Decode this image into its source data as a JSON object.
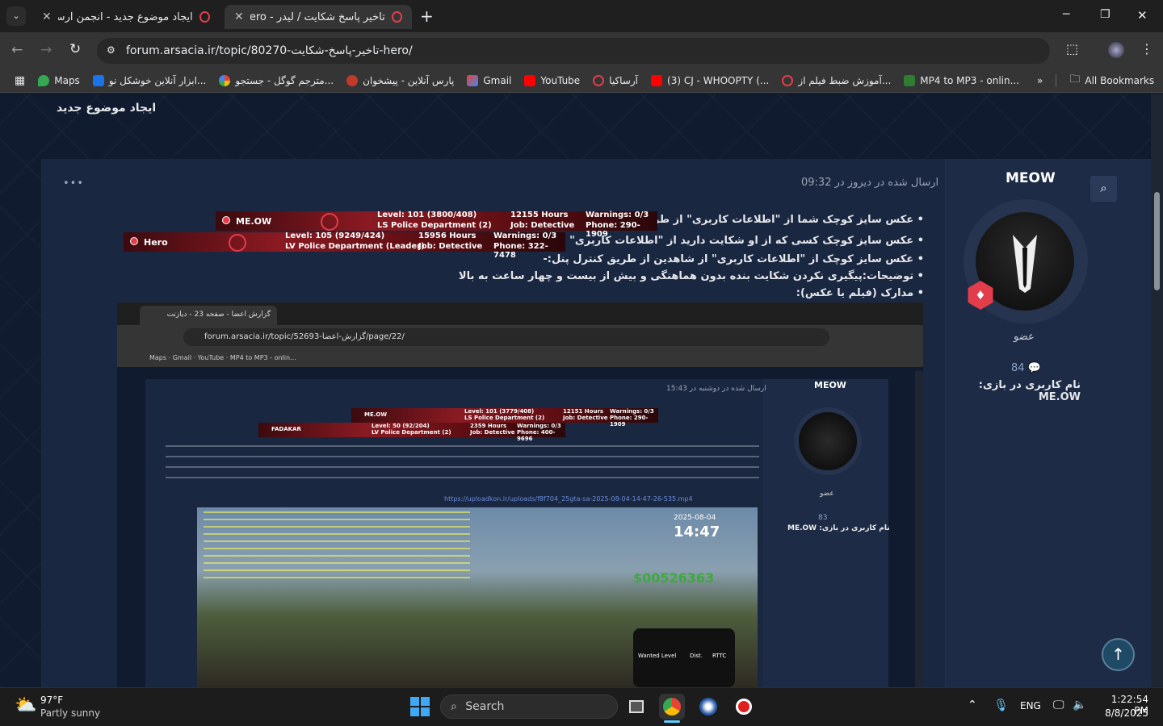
{
  "tabs": [
    {
      "label": "ایجاد موضوع جدید - انجمن آرساکیا",
      "active": false
    },
    {
      "label": "تاخیر پاسخ شکایت / لیدر - hero",
      "active": true
    }
  ],
  "new_tab": "+",
  "window": {
    "min": "─",
    "max": "❐",
    "close": "✕"
  },
  "url": "forum.arsacia.ir/topic/80270-تاخیر-پاسخ-شکایت-hero/",
  "bookmarks": [
    "Maps",
    "ابزار آنلاین خوشکل نو...",
    "مترجم گوگل - جستجو...",
    "پارس آنلاین - پیشخوان",
    "Gmail",
    "YouTube",
    "آرساکیا",
    "(3) CJ - WHOOPTY (...",
    "آموزش ضبط فیلم از...",
    "MP4 to MP3 - onlin..."
  ],
  "bookmarks_more": "»",
  "all_bookmarks": "All Bookmarks",
  "page": {
    "new_topic": "ایجاد موضوع جدید",
    "post_meta": "ارسال شده در دیروز در 09:32",
    "more": "•••",
    "author": "MEOW",
    "role": "عضو",
    "post_count": "84",
    "ingame_label": "نام کاربری در بازی: ME.OW",
    "lines": [
      "• عکس سایز کوچک شما از \"اطلاعات کاربری\" از طریق کنترل پنل:",
      "• عکس سایز کوچک کسی که از او شکایت دارید از \"اطلاعات کاربری\" از طریق کنترل پنل:",
      "• عکس سایز کوچک از \"اطلاعات کاربری\"  از شاهدین از طریق کنترل پنل:-",
      "• توضیحات:پیگیری نکردن شکایت بنده بدون هماهنگی و بیش از بیست و چهار ساعت به بالا",
      "• مدارک (فیلم یا عکس):"
    ],
    "banner1": {
      "name": "ME.OW",
      "level": "Level: 101 (3800/408)",
      "dept": "LS Police Department (2)",
      "hours": "12155 Hours",
      "job": "Job: Detective",
      "warn": "Warnings: 0/3",
      "phone": "Phone: 290-1909"
    },
    "banner2": {
      "name": "Hero",
      "level": "Level: 105 (9249/424)",
      "dept": "LV Police Department (Leader)",
      "hours": "15956 Hours",
      "job": "Job: Detective",
      "warn": "Warnings: 0/3",
      "phone": "Phone: 322-7478"
    }
  },
  "shot": {
    "tab": "گزارش اعضا - صفحه 23 - دیازنت",
    "url": "forum.arsacia.ir/topic/52693-گزارش-اعضا/page/22/",
    "meta": "ارسال شده در دوشنبه در 15:43",
    "author": "MEOW",
    "role": "عضو",
    "count": "83",
    "ingame": "نام کاربری در بازی: ME.OW",
    "link": "https://uploadkon.ir/uploads/f8f704_25gta-sa-2025-08-04-14-47-26-535.mp4",
    "b1": {
      "name": "ME.OW",
      "level": "Level: 101 (3779/408)",
      "dept": "LS Police Department (2)",
      "hours": "12151 Hours",
      "job": "Job: Detective",
      "warn": "Warnings: 0/3",
      "phone": "Phone: 290-1909"
    },
    "b2": {
      "name": "FADAKAR",
      "level": "Level: 50 (92/204)",
      "dept": "LV Police Department (2)",
      "hours": "2359 Hours",
      "job": "Job: Detective",
      "warn": "Warnings: 0/3",
      "phone": "Phone: 400-9696"
    },
    "game_date": "2025-08-04",
    "game_time": "14:47",
    "money": "$00526363",
    "wanted": "Wanted Level",
    "dist": "Dist.",
    "rttc": "RTTC"
  },
  "taskbar": {
    "temp": "97°F",
    "weather": "Partly sunny",
    "search": "Search",
    "lang": "ENG",
    "time": "1:22:54 PM",
    "date": "8/8/2025"
  },
  "colors": {
    "accent": "#e23d4b",
    "page_bg": "#101b30",
    "panel": "#1a2740",
    "scroll_btn": "#1f4a66"
  }
}
